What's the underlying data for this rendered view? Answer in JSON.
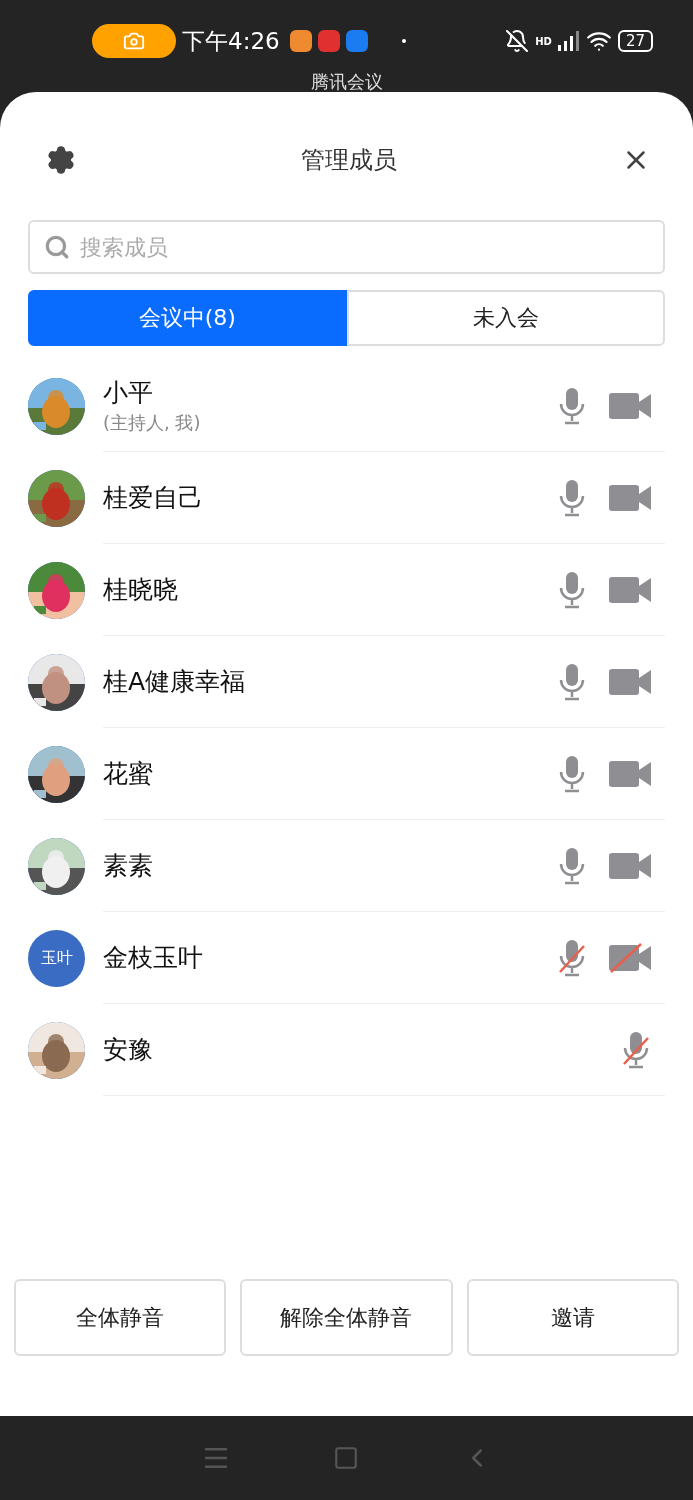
{
  "status_bar": {
    "time": "下午4:26",
    "battery": "27",
    "network": "HD"
  },
  "background_app": {
    "title": "腾讯会议"
  },
  "sheet": {
    "title": "管理成员"
  },
  "search": {
    "placeholder": "搜索成员"
  },
  "tabs": [
    {
      "label": "会议中(8)",
      "selected": true
    },
    {
      "label": "未入会",
      "selected": false
    }
  ],
  "members": [
    {
      "name": "小平",
      "role": "(主持人, 我)",
      "muted": false,
      "camera_off": false
    },
    {
      "name": "桂爱自己",
      "muted": false,
      "camera_off": false
    },
    {
      "name": "桂晓晓",
      "muted": false,
      "camera_off": false
    },
    {
      "name": "桂A健康幸福",
      "muted": false,
      "camera_off": false
    },
    {
      "name": "花蜜",
      "muted": false,
      "camera_off": false
    },
    {
      "name": "素素",
      "muted": false,
      "camera_off": false
    },
    {
      "name": "金枝玉叶",
      "avatar": {
        "kind": "initials",
        "text": "玉叶"
      },
      "muted": true,
      "camera_off": true
    },
    {
      "name": "安豫",
      "muted": true
    }
  ],
  "buttons": [
    "全体静音",
    "解除全体静音",
    "邀请"
  ]
}
